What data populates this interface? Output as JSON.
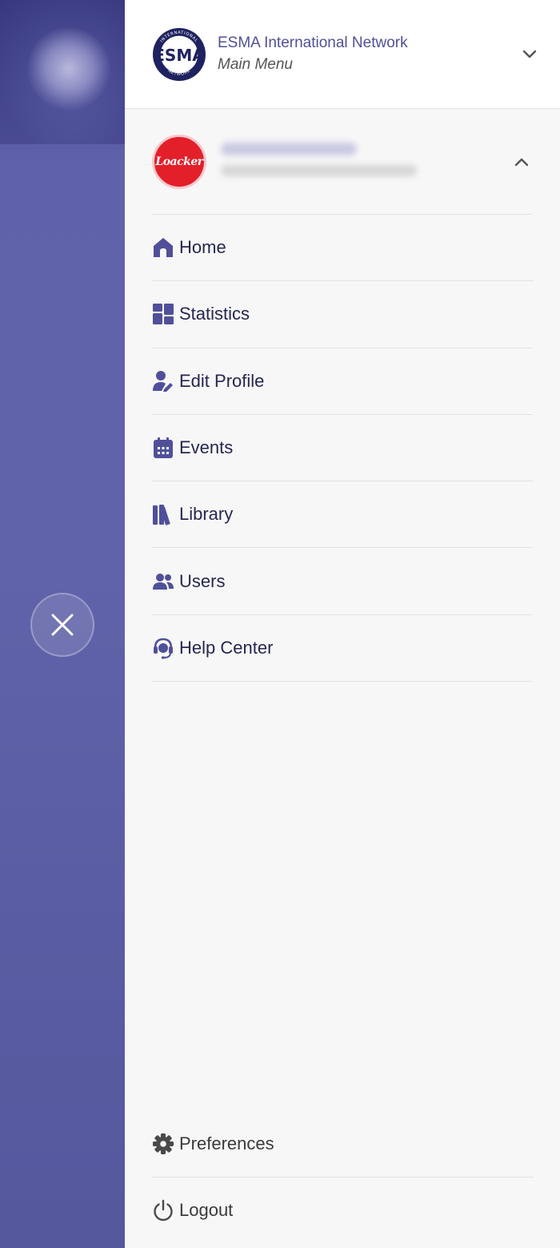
{
  "header": {
    "title": "ESMA International Network",
    "subtitle": "Main Menu",
    "logo_text": "ESMA",
    "logo_ring_text": "INTERNATIONAL NETWORK"
  },
  "account": {
    "logo_text": "Loacker"
  },
  "menu": {
    "items": [
      {
        "label": "Home",
        "icon": "home-icon"
      },
      {
        "label": "Statistics",
        "icon": "dashboard-icon"
      },
      {
        "label": "Edit Profile",
        "icon": "user-edit-icon"
      },
      {
        "label": "Events",
        "icon": "calendar-icon"
      },
      {
        "label": "Library",
        "icon": "books-icon"
      },
      {
        "label": "Users",
        "icon": "users-icon"
      },
      {
        "label": "Help Center",
        "icon": "headset-icon"
      }
    ]
  },
  "footer": {
    "preferences_label": "Preferences",
    "logout_label": "Logout"
  },
  "colors": {
    "accent": "#50509a",
    "backdrop": "#5a5ca3",
    "brand_red": "#e31f2a"
  }
}
